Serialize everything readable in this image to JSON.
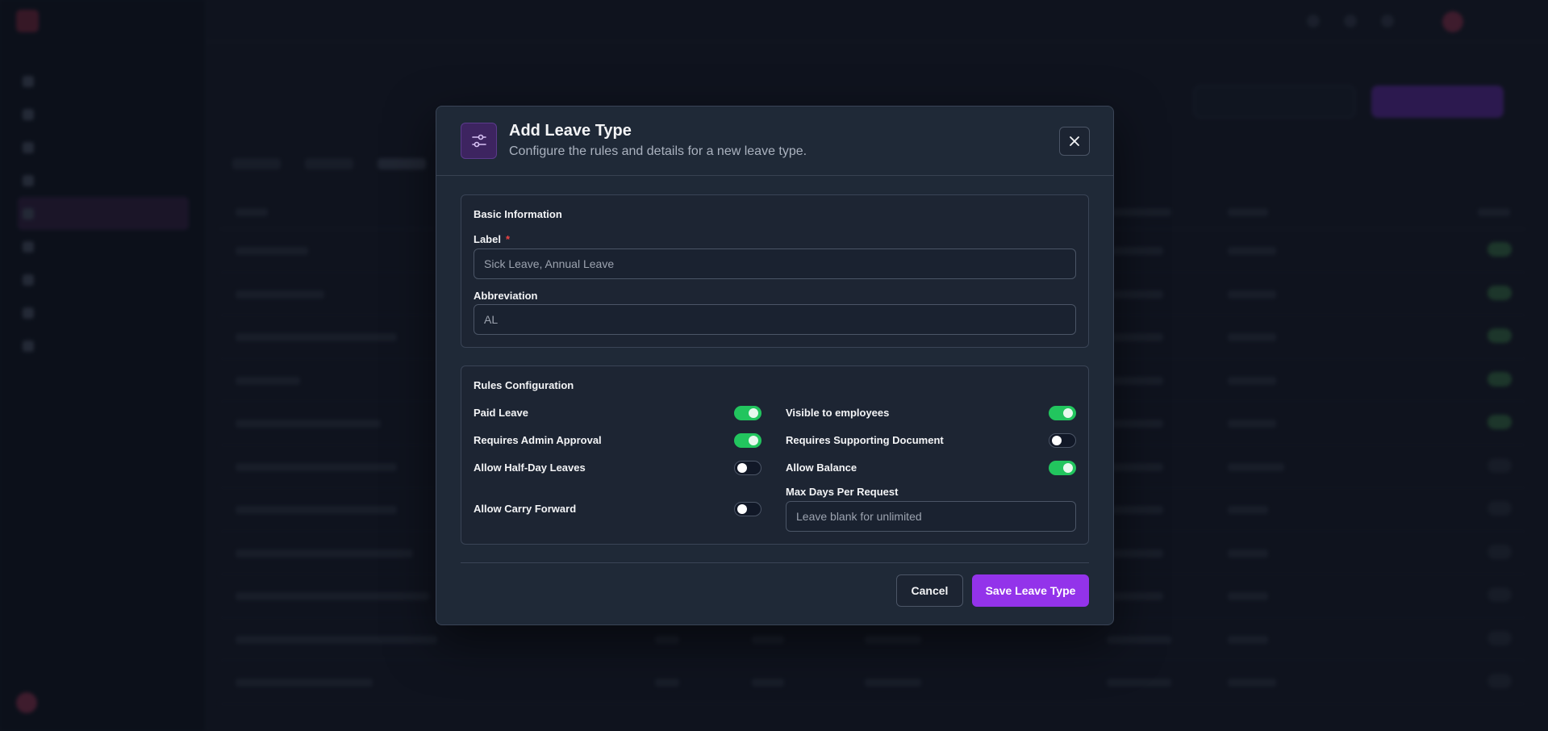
{
  "modal": {
    "title": "Add Leave Type",
    "subtitle": "Configure the rules and details for a new leave type.",
    "basic_section": {
      "title": "Basic Information",
      "label_field": {
        "label": "Label",
        "required_marker": "*",
        "placeholder": "Sick Leave, Annual Leave",
        "value": ""
      },
      "abbreviation_field": {
        "label": "Abbreviation",
        "placeholder": "AL",
        "value": ""
      }
    },
    "rules_section": {
      "title": "Rules Configuration",
      "paid_leave": {
        "label": "Paid Leave",
        "enabled": true
      },
      "visible_to_employees": {
        "label": "Visible to employees",
        "enabled": true
      },
      "requires_admin_approval": {
        "label": "Requires Admin Approval",
        "enabled": true
      },
      "requires_supporting_document": {
        "label": "Requires Supporting Document",
        "enabled": false
      },
      "allow_half_day_leaves": {
        "label": "Allow Half-Day Leaves",
        "enabled": false
      },
      "allow_balance": {
        "label": "Allow Balance",
        "enabled": true
      },
      "allow_carry_forward": {
        "label": "Allow Carry Forward",
        "enabled": false
      },
      "max_days_per_request": {
        "label": "Max Days Per Request",
        "placeholder": "Leave blank for unlimited",
        "value": ""
      }
    },
    "buttons": {
      "cancel": "Cancel",
      "save": "Save Leave Type"
    }
  },
  "colors": {
    "accent": "#9333ea",
    "toggle_on": "#22c55e",
    "required": "#ef4444",
    "modal_bg": "#1f2937"
  },
  "icons": {
    "header": "sliders-icon",
    "close": "close-icon"
  }
}
